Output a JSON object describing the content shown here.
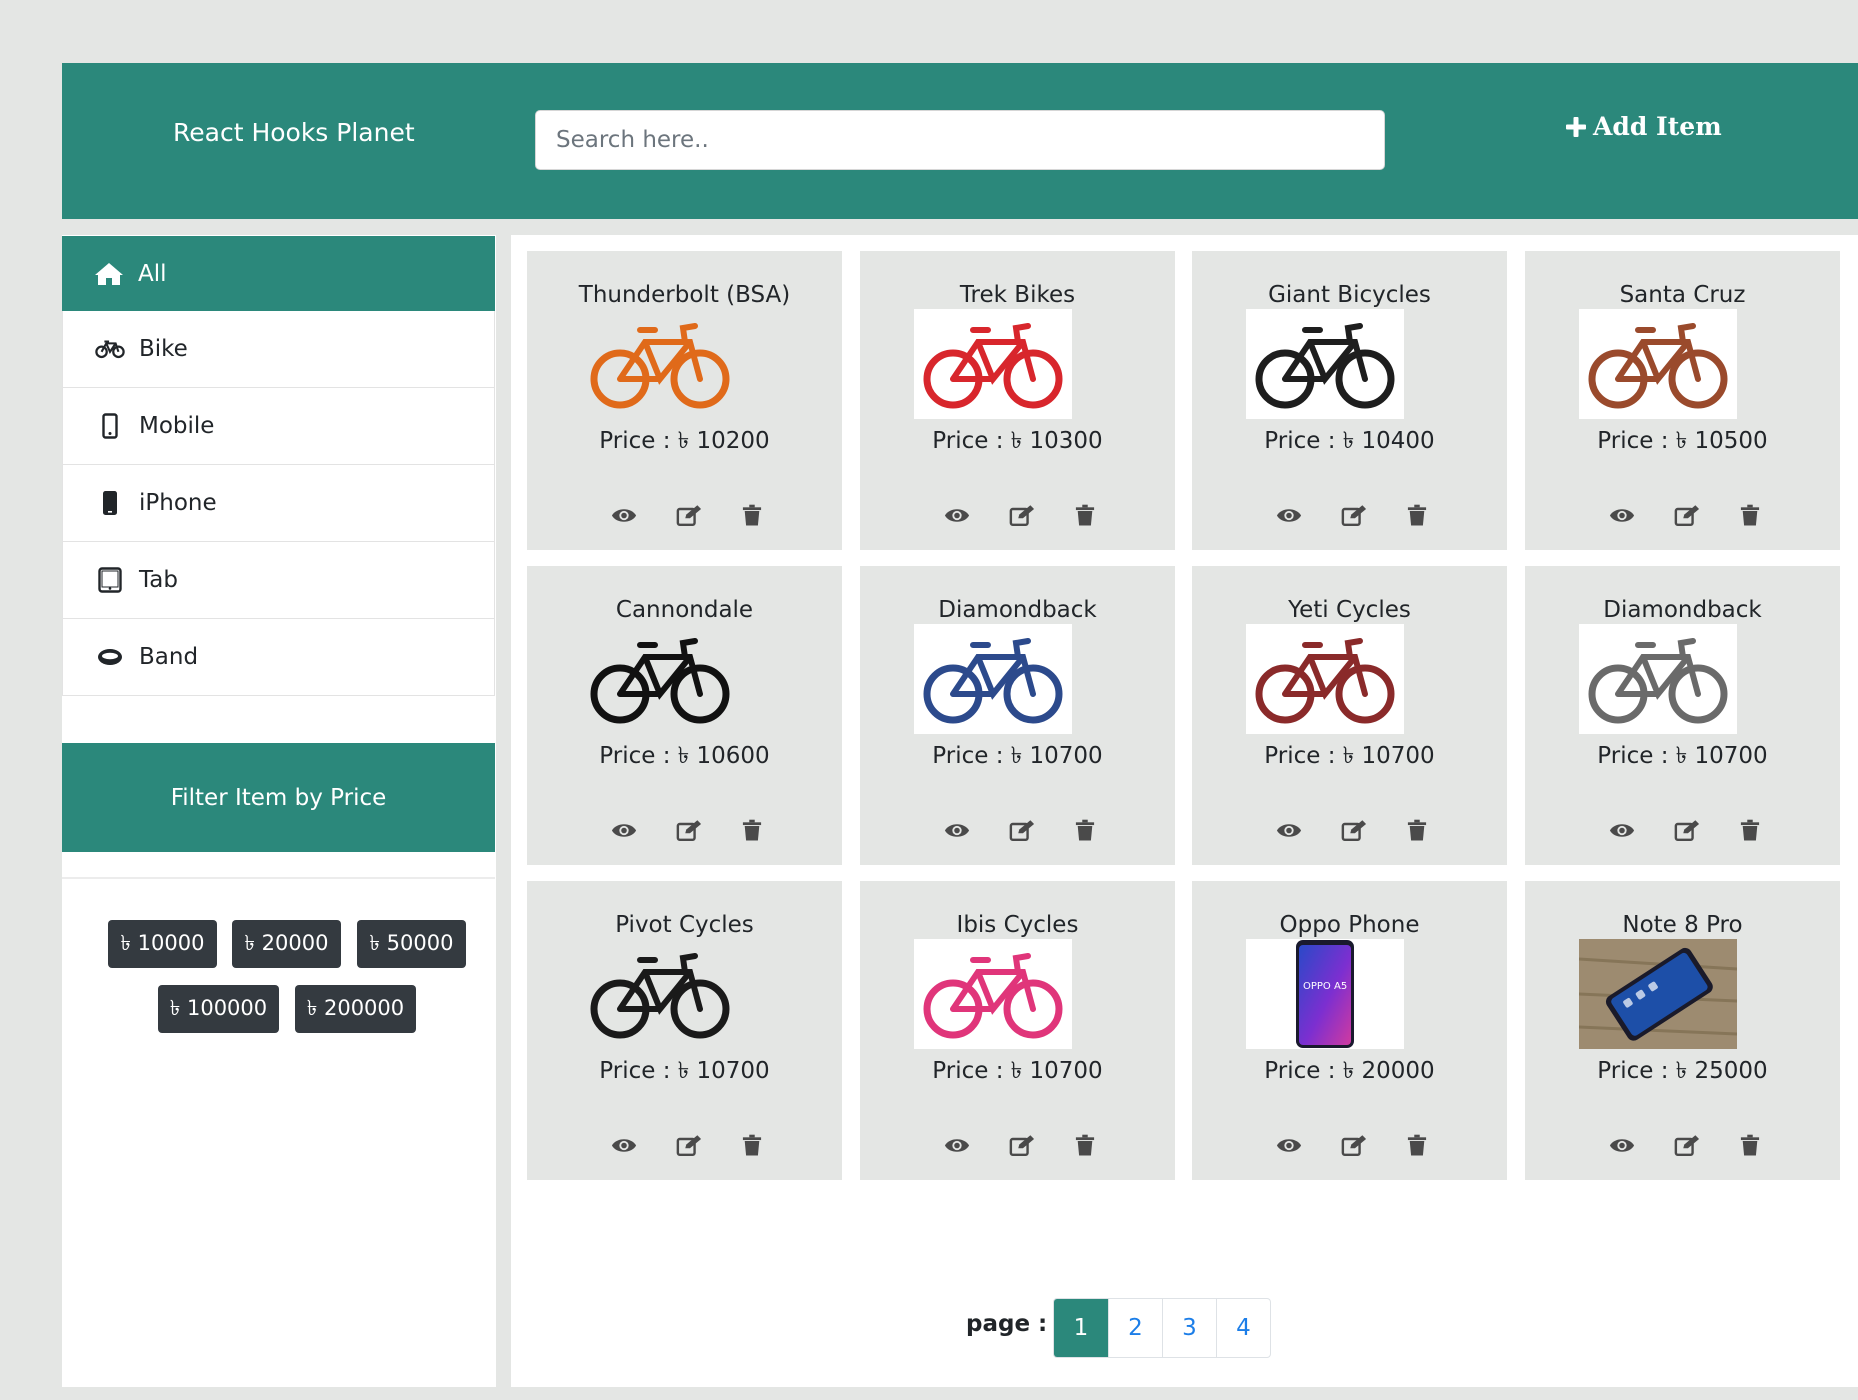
{
  "header": {
    "brand": "React Hooks Planet",
    "search_placeholder": "Search here..",
    "add_item_label": "Add Item"
  },
  "categories": [
    {
      "label": "All",
      "icon": "home-icon",
      "active": true
    },
    {
      "label": "Bike",
      "icon": "bicycle-icon",
      "active": false
    },
    {
      "label": "Mobile",
      "icon": "mobile-icon",
      "active": false
    },
    {
      "label": "iPhone",
      "icon": "phone-icon",
      "active": false
    },
    {
      "label": "Tab",
      "icon": "tablet-icon",
      "active": false
    },
    {
      "label": "Band",
      "icon": "band-icon",
      "active": false
    }
  ],
  "filter": {
    "title": "Filter Item by Price",
    "prices": [
      "৳ 10000",
      "৳ 20000",
      "৳ 50000",
      "৳ 100000",
      "৳ 200000"
    ]
  },
  "products": [
    {
      "name": "Thunderbolt (BSA)",
      "price": "Price : ৳ 10200",
      "image": "bike-orange"
    },
    {
      "name": "Trek Bikes",
      "price": "Price : ৳ 10300",
      "image": "bike-red"
    },
    {
      "name": "Giant Bicycles",
      "price": "Price : ৳ 10400",
      "image": "bike-black-suspension"
    },
    {
      "name": "Santa Cruz",
      "price": "Price : ৳ 10500",
      "image": "bike-cruiser"
    },
    {
      "name": "Cannondale",
      "price": "Price : ৳ 10600",
      "image": "bike-black"
    },
    {
      "name": "Diamondback",
      "price": "Price : ৳ 10700",
      "image": "bike-blue"
    },
    {
      "name": "Yeti Cycles",
      "price": "Price : ৳ 10700",
      "image": "bike-maroon"
    },
    {
      "name": "Diamondback",
      "price": "Price : ৳ 10700",
      "image": "bike-bmx"
    },
    {
      "name": "Pivot Cycles",
      "price": "Price : ৳ 10700",
      "image": "bike-black-city"
    },
    {
      "name": "Ibis Cycles",
      "price": "Price : ৳ 10700",
      "image": "bike-pink-kids"
    },
    {
      "name": "Oppo Phone",
      "price": "Price : ৳ 20000",
      "image": "phone-oppo",
      "image_text": "OPPO A5"
    },
    {
      "name": "Note 8 Pro",
      "price": "Price : ৳ 25000",
      "image": "phone-note"
    }
  ],
  "pagination": {
    "label": "page :",
    "pages": [
      "1",
      "2",
      "3",
      "4"
    ],
    "current": "1"
  },
  "colors": {
    "primary": "#2b887b",
    "dark_button": "#343a40",
    "link": "#1c7ee8",
    "card_bg": "#e4e6e4"
  }
}
